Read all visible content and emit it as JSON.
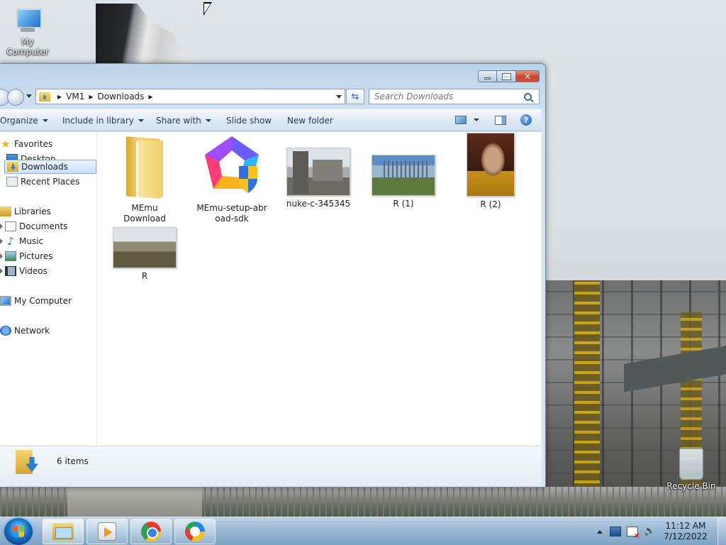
{
  "desktop": {
    "icons": [
      {
        "label": "My Computer"
      },
      {
        "label": "Recycle Bin"
      }
    ]
  },
  "window": {
    "breadcrumbs": [
      "VM1",
      "Downloads"
    ],
    "search_placeholder": "Search Downloads",
    "toolbar": {
      "organize": "Organize",
      "include_in_library": "Include in library",
      "share_with": "Share with",
      "slide_show": "Slide show",
      "new_folder": "New folder"
    },
    "nav": {
      "favorites": "Favorites",
      "desktop": "Desktop",
      "downloads": "Downloads",
      "recent_places": "Recent Places",
      "libraries": "Libraries",
      "documents": "Documents",
      "music": "Music",
      "pictures": "Pictures",
      "videos": "Videos",
      "my_computer": "My Computer",
      "network": "Network"
    },
    "files": [
      {
        "name": "MEmu Download",
        "type": "folder"
      },
      {
        "name": "MEmu-setup-abroad-sdk",
        "type": "installer"
      },
      {
        "name": "nuke-c-345345",
        "type": "image"
      },
      {
        "name": "R (1)",
        "type": "image"
      },
      {
        "name": "R (2)",
        "type": "image"
      },
      {
        "name": "R",
        "type": "image"
      }
    ],
    "file_name_lines": {
      "memu_setup_line1": "MEmu-setup-abr",
      "memu_setup_line2": "oad-sdk"
    },
    "status": "6 items"
  },
  "taskbar": {
    "time": "11:12 AM",
    "date": "7/12/2022",
    "pinned": [
      "windows-explorer",
      "media-player",
      "chrome",
      "vpn-app"
    ]
  },
  "colors": {
    "selection": "#cfe3fb",
    "toolbar_text": "#1e395b",
    "close_button": "#c8402a"
  }
}
